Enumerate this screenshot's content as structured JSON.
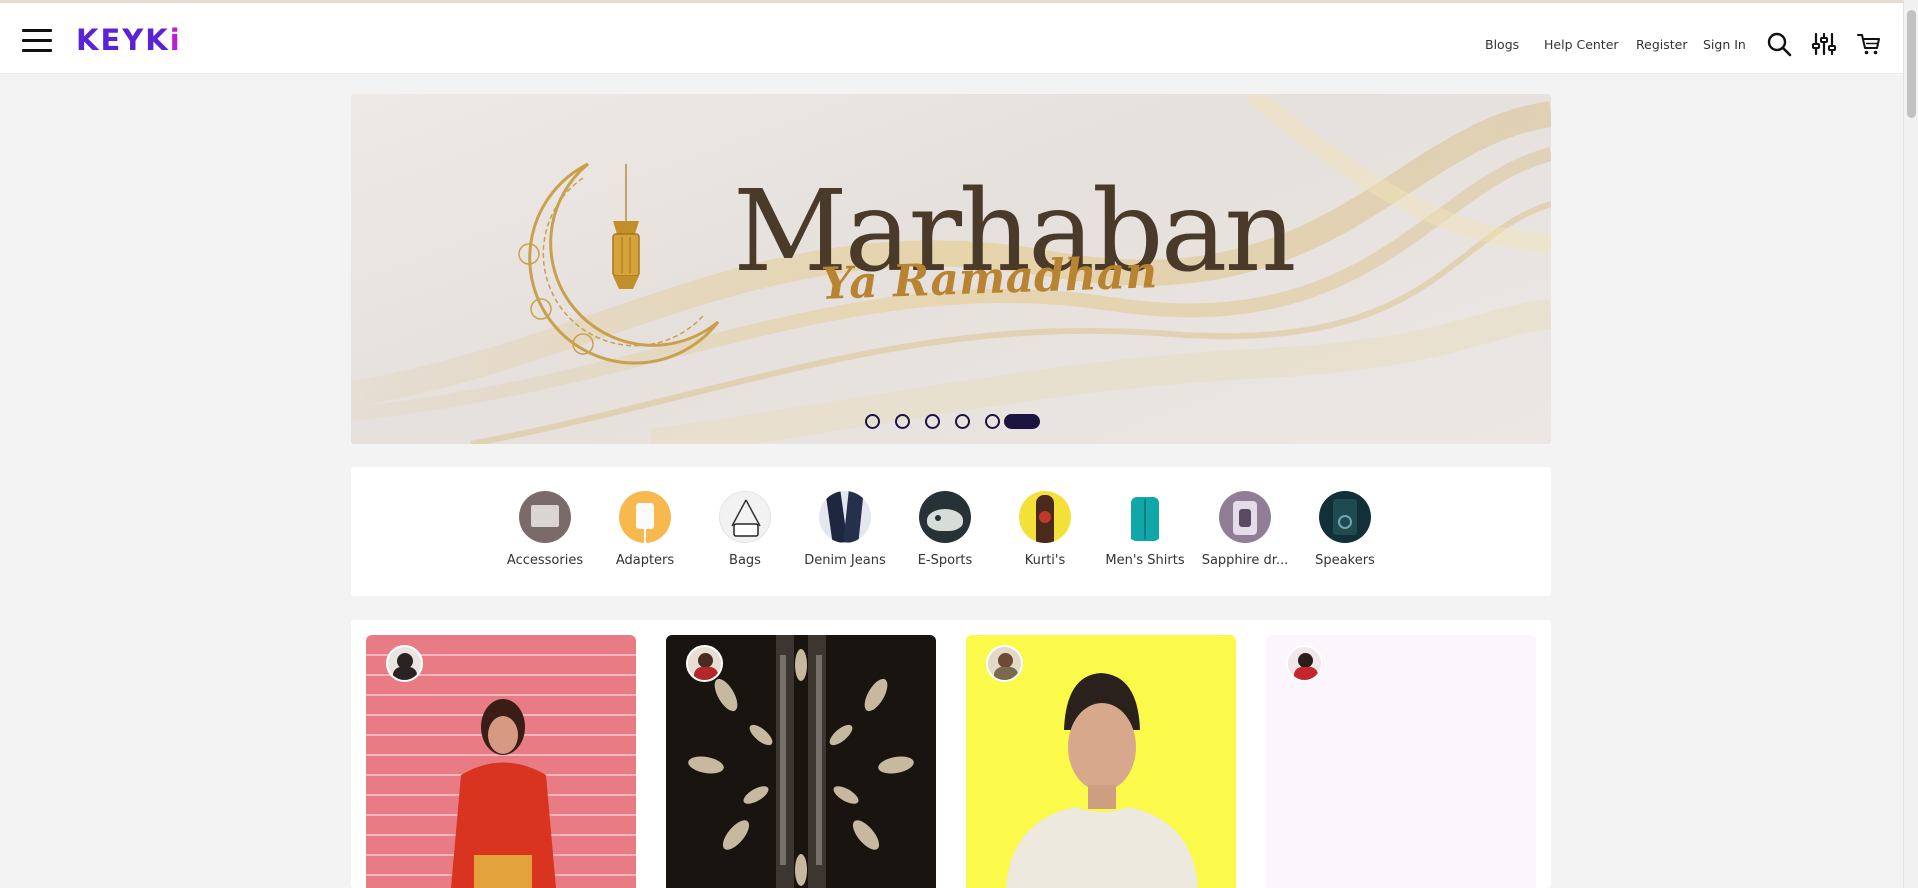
{
  "header": {
    "logo": "KEYKi",
    "nav": {
      "blogs": "Blogs",
      "help_center": "Help Center",
      "register": "Register",
      "sign_in": "Sign In"
    },
    "icons": [
      "menu-icon",
      "search-icon",
      "filter-sliders-icon",
      "cart-icon"
    ]
  },
  "banner": {
    "title": "Marhaban",
    "subtitle": "Ya Ramadhan",
    "slide_count": 6,
    "active_slide": 6
  },
  "categories": [
    {
      "label": "Accessories",
      "color": "#7b6a6a"
    },
    {
      "label": "Adapters",
      "color": "#f7b94e"
    },
    {
      "label": "Bags",
      "color": "#f2f2f2"
    },
    {
      "label": "Denim Jeans",
      "color": "#1f2740"
    },
    {
      "label": "E-Sports",
      "color": "#263238"
    },
    {
      "label": "Kurti's",
      "color": "#f3e13a"
    },
    {
      "label": "Men's Shirts",
      "color": "#0fa7a7"
    },
    {
      "label": "Sapphire dr...",
      "color": "#8f7e96"
    },
    {
      "label": "Speakers",
      "color": "#123038"
    }
  ],
  "products": [
    {
      "name": "product-card-red-top",
      "bg": "#e97b84"
    },
    {
      "name": "product-card-mirror-decor",
      "bg": "#1a1410"
    },
    {
      "name": "product-card-mens-tee",
      "bg": "#fbf94a"
    },
    {
      "name": "product-card-blank",
      "bg": "#fbf6fb"
    }
  ]
}
